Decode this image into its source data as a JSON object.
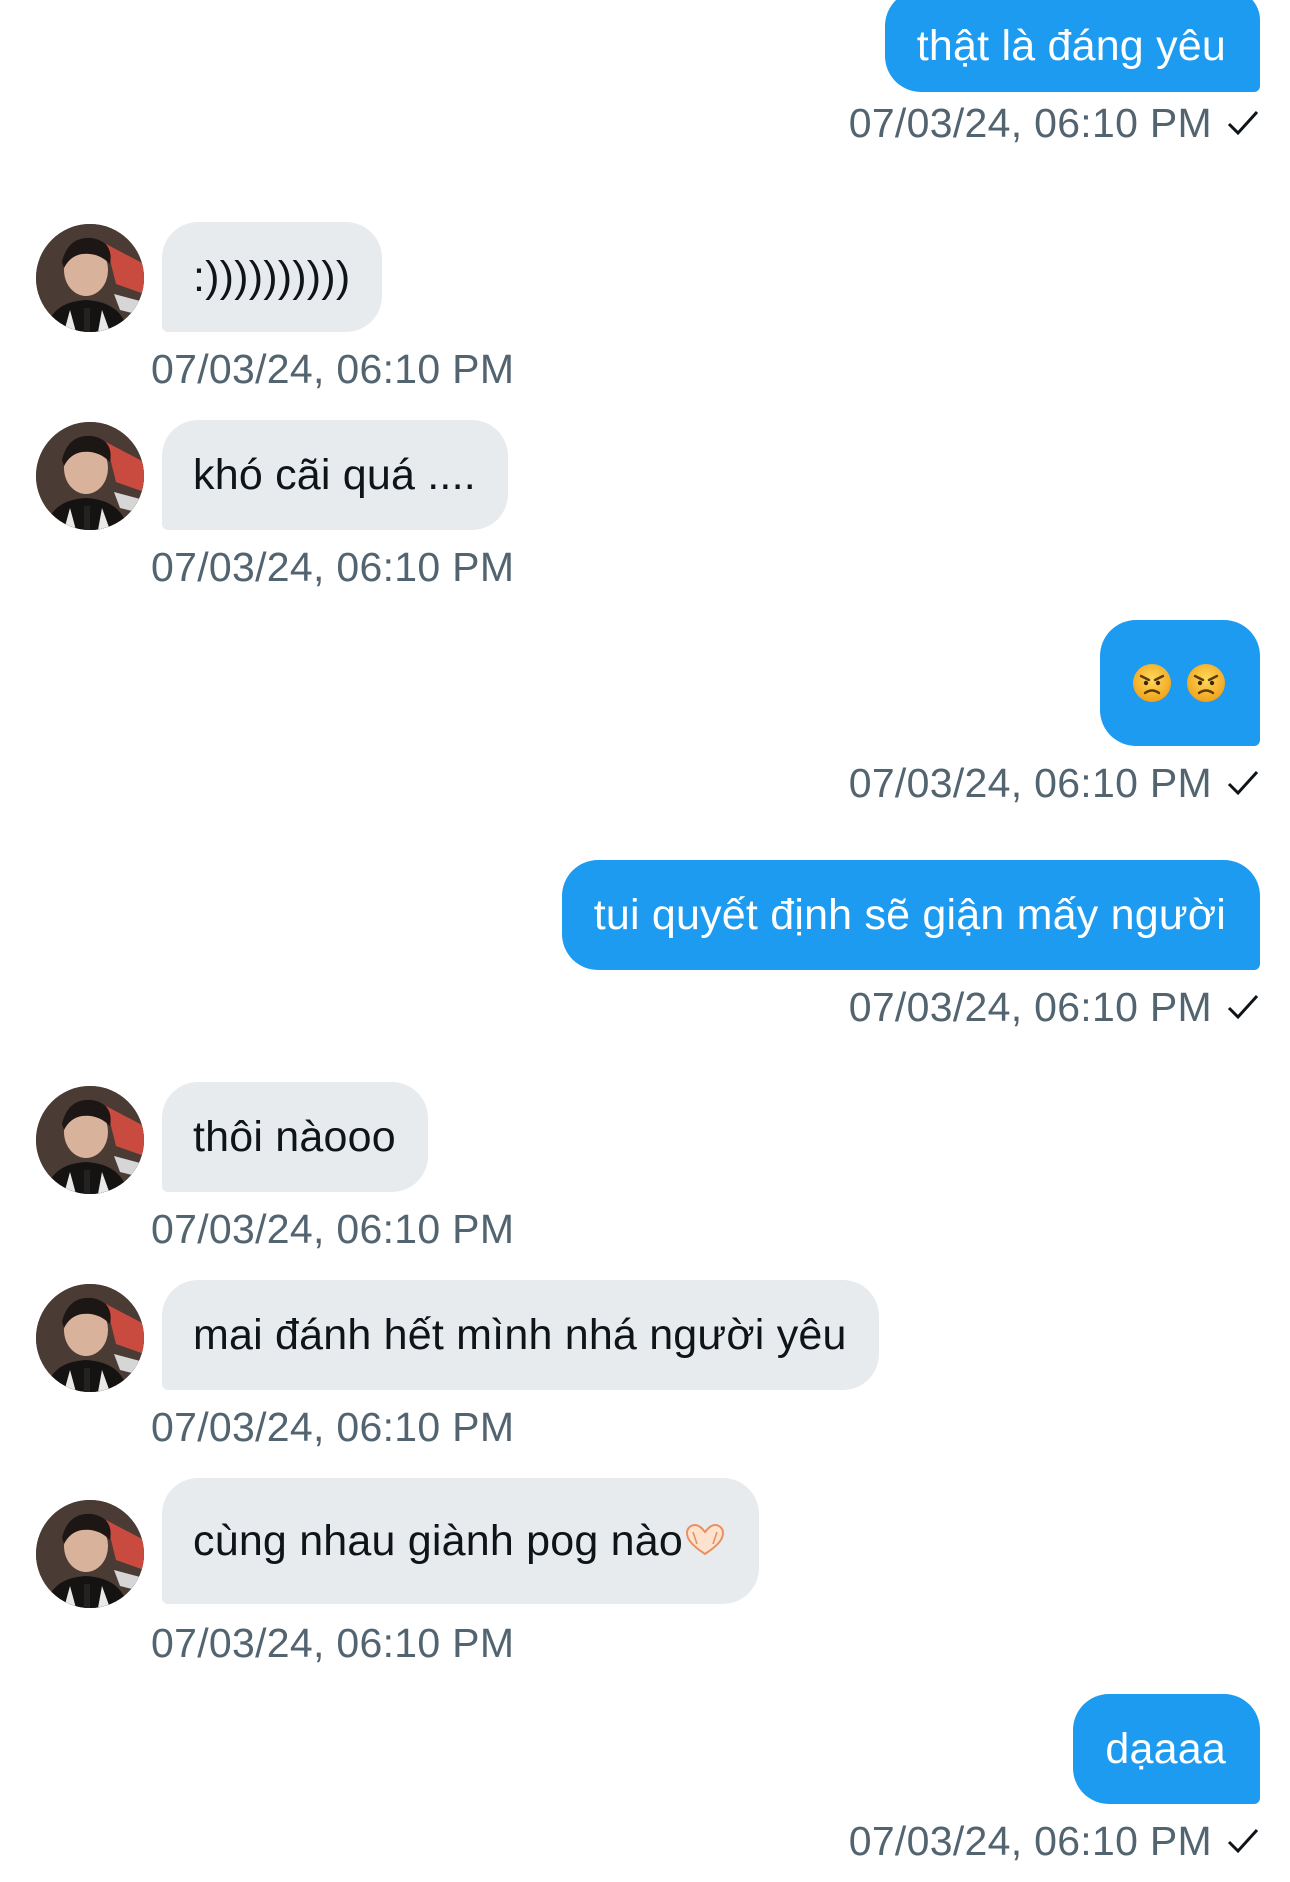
{
  "messages": [
    {
      "side": "out",
      "text": "thật là đáng yêu",
      "time": "07/03/24, 06:10 PM"
    },
    {
      "side": "in",
      "text": ":))))))))))",
      "time": "07/03/24, 06:10 PM"
    },
    {
      "side": "in",
      "text": "khó cãi quá ....",
      "time": "07/03/24, 06:10 PM"
    },
    {
      "side": "out",
      "emoji": [
        "angry-face-icon",
        "angry-face-icon"
      ],
      "time": "07/03/24, 06:10 PM"
    },
    {
      "side": "out",
      "text": "tui quyết định sẽ giận mấy người",
      "time": "07/03/24, 06:10 PM"
    },
    {
      "side": "in",
      "text": "thôi nàooo",
      "time": "07/03/24, 06:10 PM"
    },
    {
      "side": "in",
      "text": "mai đánh hết mình nhá người yêu",
      "time": "07/03/24, 06:10 PM"
    },
    {
      "side": "in",
      "text": "cùng nhau giành pog nào",
      "trailing_emoji": "heart-hands-icon",
      "time": "07/03/24, 06:10 PM"
    },
    {
      "side": "out",
      "text": "dạaaa",
      "time": "07/03/24, 06:10 PM"
    }
  ],
  "colors": {
    "outgoing_bubble": "#1d9bf0",
    "incoming_bubble": "#e8ebee",
    "timestamp": "#536471"
  },
  "icons": {
    "sent": "check-icon"
  }
}
